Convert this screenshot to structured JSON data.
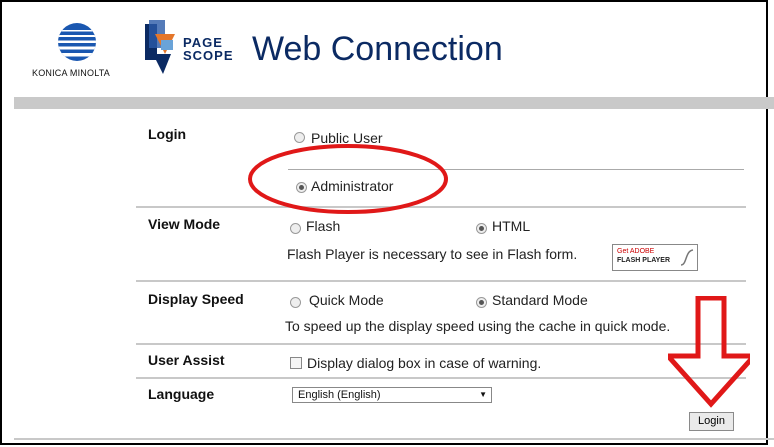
{
  "header": {
    "brand_name": "KONICA MINOLTA",
    "pagescope_top": "PAGE",
    "pagescope_bottom": "SCOPE",
    "title": "Web Connection"
  },
  "login": {
    "label": "Login",
    "options": [
      "Public User",
      "Administrator"
    ],
    "selected": "Administrator"
  },
  "view_mode": {
    "label": "View Mode",
    "options": [
      "Flash",
      "HTML"
    ],
    "selected": "HTML",
    "note": "Flash Player is necessary to see in Flash form.",
    "flash_badge_top": "Get ADOBE",
    "flash_badge_bottom": "FLASH PLAYER"
  },
  "display_speed": {
    "label": "Display Speed",
    "options": [
      "Quick Mode",
      "Standard Mode"
    ],
    "selected": "Standard Mode",
    "note": "To speed up the display speed using the cache in quick mode."
  },
  "user_assist": {
    "label": "User Assist",
    "checkbox_label": "Display dialog box in case of warning.",
    "checked": false
  },
  "language": {
    "label": "Language",
    "selected": "English (English)"
  },
  "login_button": "Login",
  "colors": {
    "annotation": "#e01818",
    "title_blue": "#0b2a63"
  }
}
